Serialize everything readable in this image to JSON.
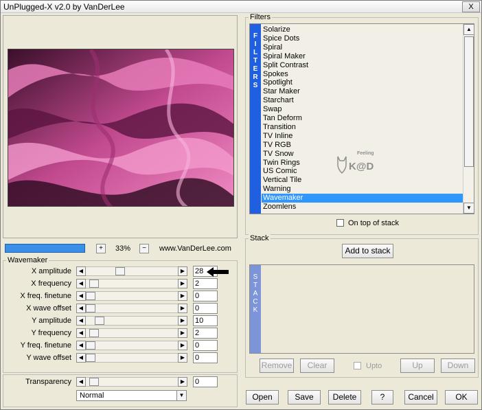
{
  "window": {
    "title": "UnPlugged-X v2.0 by VanDerLee",
    "close_label": "X"
  },
  "preview": {
    "zoom_plus": "+",
    "zoom_minus": "−",
    "zoom_percent": "33%",
    "website": "www.VanDerLee.com"
  },
  "wavemaker": {
    "group_label": "Wavemaker",
    "params": [
      {
        "label": "X amplitude",
        "value": "28",
        "fraction": 0.36
      },
      {
        "label": "X frequency",
        "value": "2",
        "fraction": 0.04
      },
      {
        "label": "X freq. finetune",
        "value": "0",
        "fraction": 0.0
      },
      {
        "label": "X wave offset",
        "value": "0",
        "fraction": 0.0
      },
      {
        "label": "Y amplitude",
        "value": "10",
        "fraction": 0.11
      },
      {
        "label": "Y frequency",
        "value": "2",
        "fraction": 0.04
      },
      {
        "label": "Y freq. finetune",
        "value": "0",
        "fraction": 0.0
      },
      {
        "label": "Y wave offset",
        "value": "0",
        "fraction": 0.0
      }
    ],
    "transparency": {
      "label": "Transparency",
      "value": "0",
      "fraction": 0.04
    },
    "blend_mode": "Normal"
  },
  "filters": {
    "group_label": "Filters",
    "side_label": [
      "F",
      "I",
      "L",
      "T",
      "E",
      "R",
      "S"
    ],
    "items": [
      "Solarize",
      "Spice Dots",
      "Spiral",
      "Spiral Maker",
      "Split Contrast",
      "Spokes",
      "Spotlight",
      "Star Maker",
      "Starchart",
      "Swap",
      "Tan Deform",
      "Transition",
      "TV Inline",
      "TV RGB",
      "TV Snow",
      "Twin Rings",
      "US Comic",
      "Vertical Tile",
      "Warning",
      "Wavemaker",
      "Zoomlens"
    ],
    "selected": "Wavemaker",
    "on_top_label": "On top of stack"
  },
  "stack": {
    "group_label": "Stack",
    "add_label": "Add to stack",
    "side_label": [
      "S",
      "T",
      "A",
      "C",
      "K"
    ],
    "remove_label": "Remove",
    "clear_label": "Clear",
    "upto_label": "Upto",
    "up_label": "Up",
    "down_label": "Down"
  },
  "footer": {
    "open": "Open",
    "save": "Save",
    "delete": "Delete",
    "help": "?",
    "cancel": "Cancel",
    "ok": "OK"
  },
  "watermark": {
    "text": "K@D",
    "small": "Feeling"
  },
  "colors": {
    "selection": "#3297fd",
    "filters_side": "#1f5fe0",
    "stack_side": "#7d95d8",
    "zoom_bar": "#3a8fe8"
  }
}
